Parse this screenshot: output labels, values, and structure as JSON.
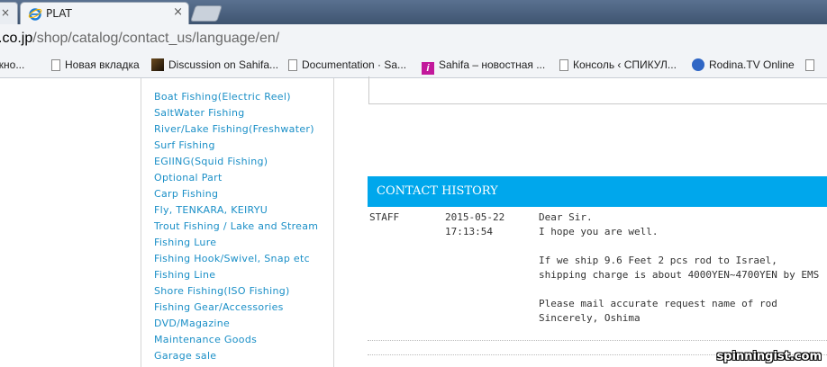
{
  "browser": {
    "tabs": [
      {
        "label": "PLAT",
        "active": true
      }
    ],
    "partial_tab_close": "×",
    "active_tab_close": "×",
    "url_domain": ".co.jp",
    "url_path": "/shop/catalog/contact_us/language/en/"
  },
  "bookmarks": [
    {
      "label": "жно...",
      "icon": "none"
    },
    {
      "label": "Новая вкладка",
      "icon": "page-icon"
    },
    {
      "label": "Discussion on Sahifa...",
      "icon": "image-icon"
    },
    {
      "label": "Documentation · Sa...",
      "icon": "page-icon"
    },
    {
      "label": "Sahifa – новостная ...",
      "icon": "i-icon"
    },
    {
      "label": "Консоль ‹ СПИКУЛ...",
      "icon": "page-icon"
    },
    {
      "label": "Rodina.TV Online",
      "icon": "tv-icon"
    }
  ],
  "sidebar": {
    "categories": [
      "Boat Fishing(Electric Reel)",
      "SaltWater Fishing",
      "River/Lake Fishing(Freshwater)",
      "Surf Fishing",
      "EGIING(Squid Fishing)",
      "Optional Part",
      "Carp Fishing",
      "Fly, TENKARA, KEIRYU",
      "Trout Fishing / Lake and Stream",
      "Fishing Lure",
      "Fishing Hook/Swivel, Snap etc",
      "Fishing Line",
      "Shore Fishing(ISO Fishing)",
      "Fishing Gear/Accessories",
      "DVD/Magazine",
      "Maintenance Goods",
      "Garage sale"
    ]
  },
  "history": {
    "title": "CONTACT HISTORY",
    "entry": {
      "author": "STAFF",
      "date": "2015-05-22",
      "time": "17:13:54",
      "lines": [
        "Dear Sir.",
        "I hope you are well.",
        "",
        "If we ship 9.6 Feet 2 pcs rod to Israel,",
        "shipping charge is about 4000YEN~4700YEN by EMS",
        "",
        "Please mail accurate request name of rod",
        "Sincerely, Oshima"
      ]
    }
  },
  "watermark": "spinningist.com",
  "colors": {
    "link": "#1a8fc7",
    "header_bar": "#00a7ec"
  }
}
